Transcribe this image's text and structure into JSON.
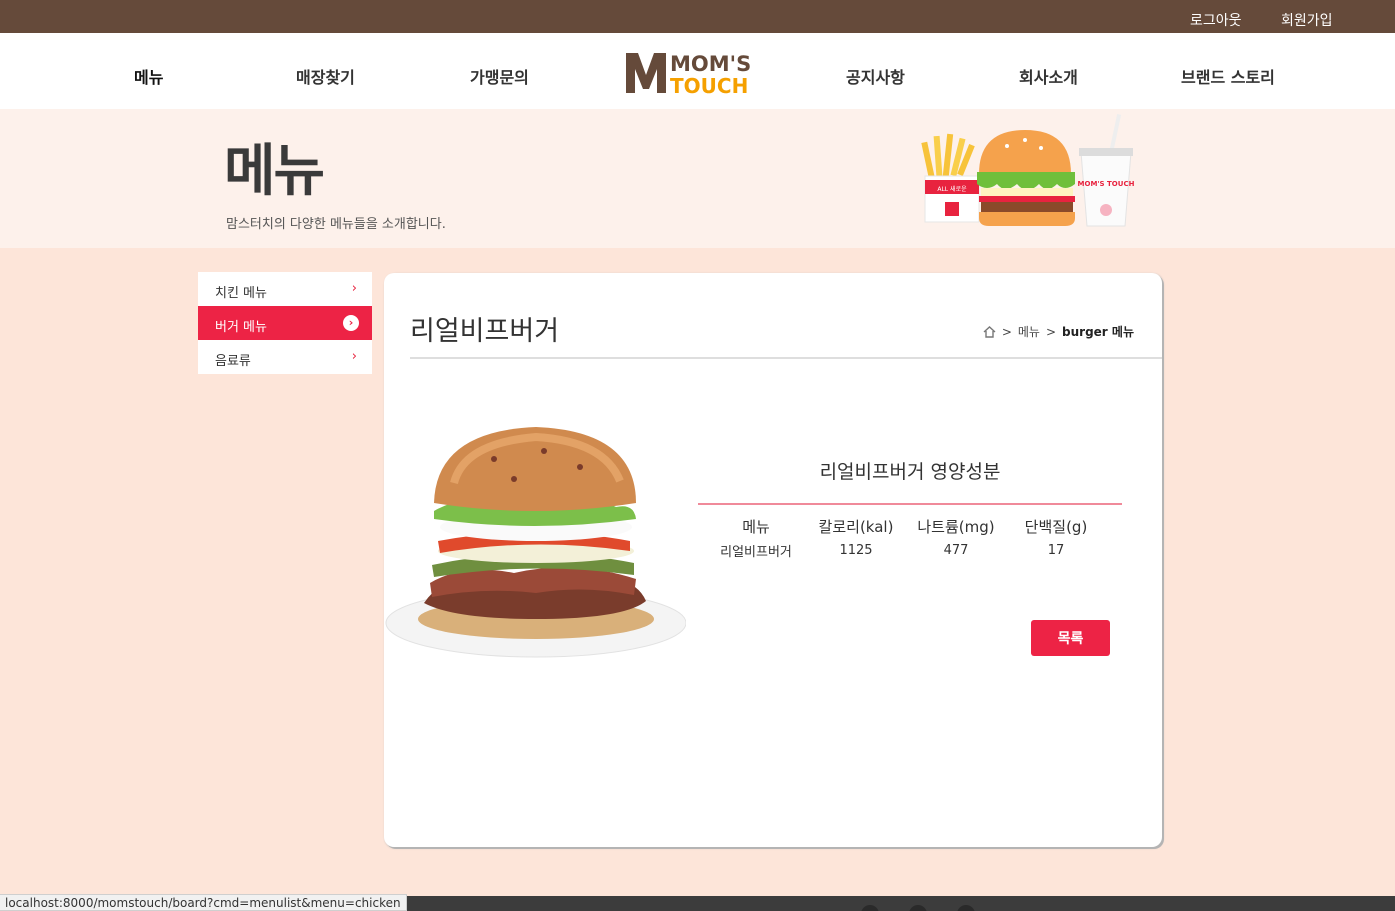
{
  "topbar": {
    "logout": "로그아웃",
    "signup": "회원가입"
  },
  "nav": {
    "menu": "메뉴",
    "store": "매장찾기",
    "franchise": "가맹문의",
    "notice": "공지사항",
    "company": "회사소개",
    "brand": "브랜드 스토리",
    "logo_top": "MOM'S",
    "logo_bottom": "TOUCH"
  },
  "banner": {
    "title": "메뉴",
    "subtitle": "맘스터치의 다양한 메뉴들을 소개합니다.",
    "cup_text": "MOM'S TOUCH",
    "fries_text": "ALL 새로운"
  },
  "sidebar": {
    "items": [
      {
        "label": "치킨 메뉴",
        "active": false
      },
      {
        "label": "버거 메뉴",
        "active": true
      },
      {
        "label": "음료류",
        "active": false
      }
    ]
  },
  "panel": {
    "title": "리얼비프버거",
    "breadcrumb": {
      "sep": ">",
      "menu": "메뉴",
      "current": "burger 메뉴"
    }
  },
  "nutrition": {
    "title": "리얼비프버거 영양성분",
    "headers": [
      "메뉴",
      "칼로리(kal)",
      "나트륨(mg)",
      "단백질(g)"
    ],
    "row": [
      "리얼비프버거",
      "1125",
      "477",
      "17"
    ]
  },
  "buttons": {
    "list": "목록"
  },
  "status_url": "localhost:8000/momstouch/board?cmd=menulist&menu=chicken",
  "colors": {
    "brown": "#654a3a",
    "red": "#ed2345",
    "orange": "#f5a000",
    "peach": "#fde5d9"
  }
}
